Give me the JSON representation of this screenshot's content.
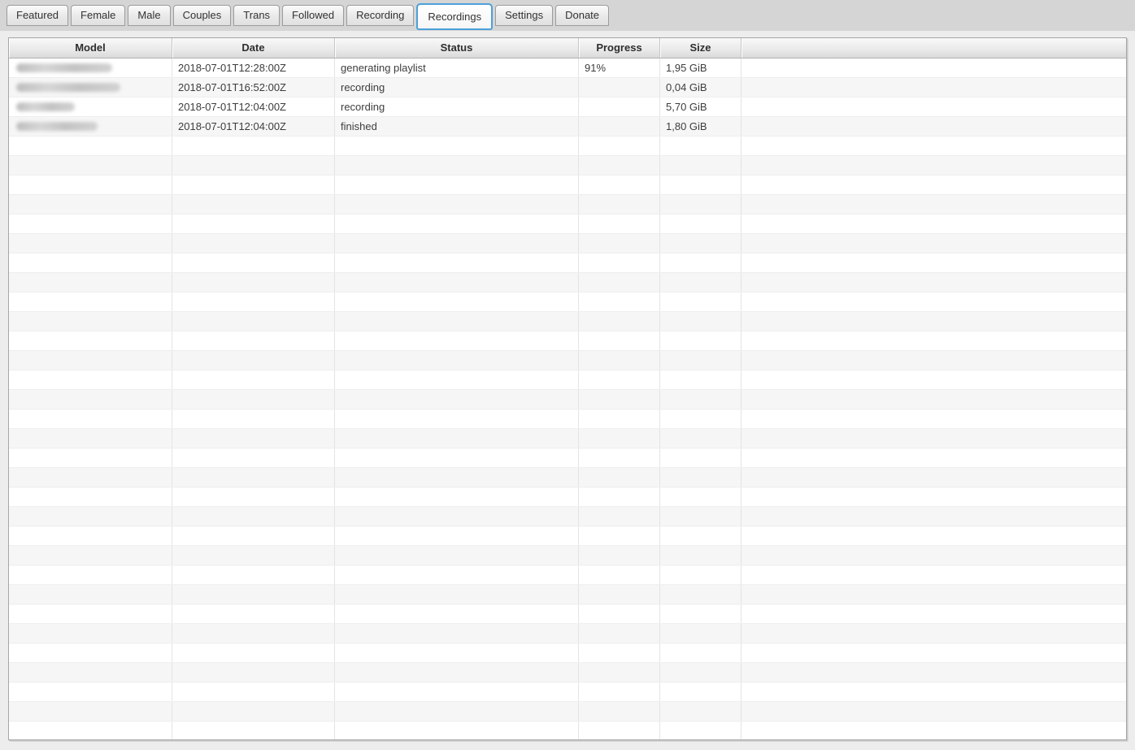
{
  "tabbar": {
    "tabs": [
      {
        "label": "Featured",
        "active": false
      },
      {
        "label": "Female",
        "active": false
      },
      {
        "label": "Male",
        "active": false
      },
      {
        "label": "Couples",
        "active": false
      },
      {
        "label": "Trans",
        "active": false
      },
      {
        "label": "Followed",
        "active": false
      },
      {
        "label": "Recording",
        "active": false
      },
      {
        "label": "Recordings",
        "active": true
      },
      {
        "label": "Settings",
        "active": false
      },
      {
        "label": "Donate",
        "active": false
      }
    ]
  },
  "table": {
    "columns": [
      "Model",
      "Date",
      "Status",
      "Progress",
      "Size",
      ""
    ],
    "rows": [
      {
        "model": "",
        "model_redacted": true,
        "model_blob_width": 118,
        "date": "2018-07-01T12:28:00Z",
        "status": "generating playlist",
        "progress": "91%",
        "size": "1,95 GiB"
      },
      {
        "model": "",
        "model_redacted": true,
        "model_blob_width": 128,
        "date": "2018-07-01T16:52:00Z",
        "status": "recording",
        "progress": "",
        "size": "0,04 GiB"
      },
      {
        "model": "",
        "model_redacted": true,
        "model_blob_width": 72,
        "date": "2018-07-01T12:04:00Z",
        "status": "recording",
        "progress": "",
        "size": "5,70 GiB"
      },
      {
        "model": "",
        "model_redacted": true,
        "model_blob_width": 100,
        "date": "2018-07-01T12:04:00Z",
        "status": "finished",
        "progress": "",
        "size": "1,80 GiB"
      }
    ],
    "empty_row_count": 31
  },
  "colors": {
    "accent_active_tab_border": "#4da0d8",
    "tabbar_background": "#d5d5d5",
    "content_background": "#ededed",
    "row_alternate": "#f6f6f6",
    "header_gradient_top": "#f9f9f9",
    "header_gradient_bottom": "#dadada",
    "table_border": "#a6a6a6",
    "text": "#333333"
  }
}
